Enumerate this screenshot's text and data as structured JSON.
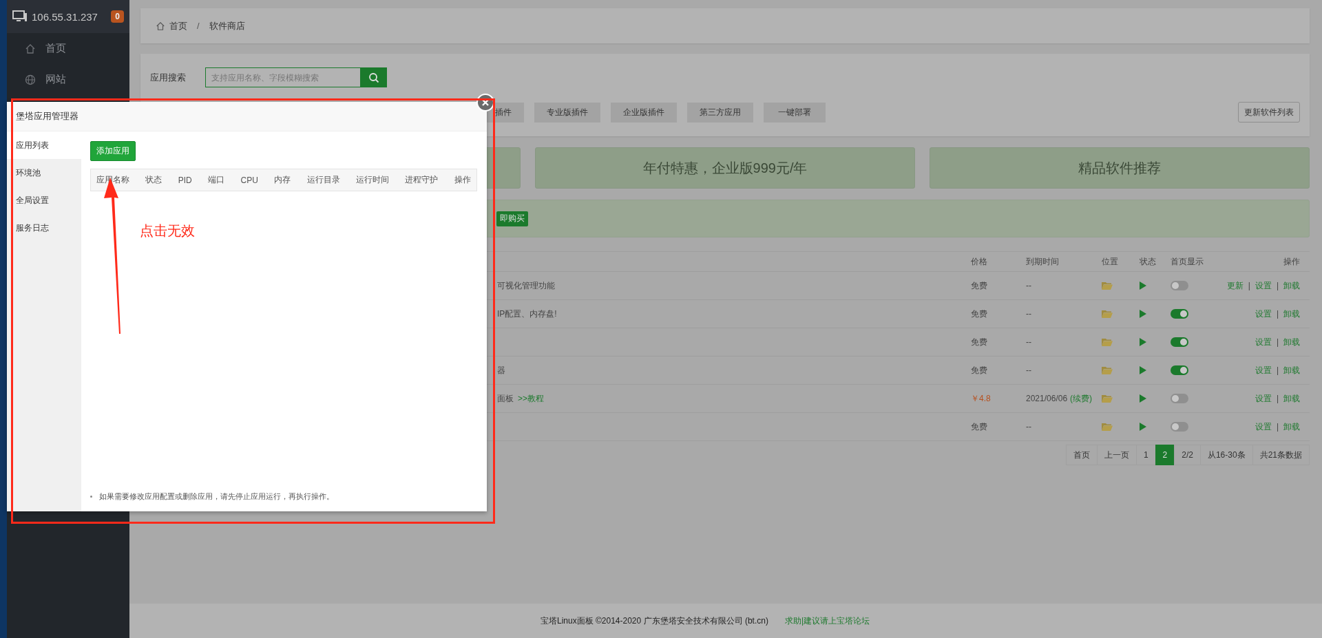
{
  "sidebar": {
    "host": "106.55.31.237",
    "badge": "0",
    "items": [
      {
        "label": "首页",
        "kind": "home"
      },
      {
        "label": "网站",
        "kind": "globe"
      }
    ]
  },
  "breadcrumb": [
    "首页",
    "软件商店"
  ],
  "breadcrumb_separator": "/",
  "search": {
    "label": "应用搜索",
    "placeholder": "支持应用名称、字段模糊搜索"
  },
  "category_tabs": [
    "插件",
    "专业版插件",
    "企业版插件",
    "第三方应用",
    "一键部署"
  ],
  "update_button": "更新软件列表",
  "banners": [
    "年付特惠，企业版999元/年",
    "精品软件推荐"
  ],
  "notice": {
    "button": "即购买"
  },
  "table": {
    "columns": [
      "价格",
      "到期时间",
      "位置",
      "状态",
      "首页显示",
      "操作"
    ],
    "separator": "|",
    "rows": [
      {
        "name": "可视化管理功能",
        "price": "免费",
        "paid": false,
        "expiry": "--",
        "home_display": false,
        "actions": [
          "更新",
          "设置",
          "卸载"
        ]
      },
      {
        "name": "IP配置、内存盘!",
        "price": "免费",
        "paid": false,
        "expiry": "--",
        "home_display": true,
        "actions": [
          "设置",
          "卸载"
        ]
      },
      {
        "price": "免费",
        "paid": false,
        "expiry": "--",
        "home_display": true,
        "actions": [
          "设置",
          "卸载"
        ]
      },
      {
        "name": "器",
        "price": "免费",
        "paid": false,
        "expiry": "--",
        "home_display": true,
        "actions": [
          "设置",
          "卸载"
        ]
      },
      {
        "name": "面板",
        "link": ">>教程",
        "price": "￥4.8",
        "paid": true,
        "expiry": "2021/06/06",
        "renew": "(续费)",
        "home_display": false,
        "actions": [
          "设置",
          "卸载"
        ]
      },
      {
        "price": "免费",
        "paid": false,
        "expiry": "--",
        "home_display": false,
        "actions": [
          "设置",
          "卸载"
        ]
      }
    ]
  },
  "pagination": [
    {
      "label": "首页",
      "selected": false
    },
    {
      "label": "上一页",
      "selected": false
    },
    {
      "label": "1",
      "selected": false
    },
    {
      "label": "2",
      "selected": true
    },
    {
      "label": "2/2",
      "selected": false
    },
    {
      "label": "从16-30条",
      "selected": false
    },
    {
      "label": "共21条数据",
      "selected": false
    }
  ],
  "footer": {
    "copyright": "宝塔Linux面板 ©2014-2020 广东堡塔安全技术有限公司 (bt.cn)",
    "link": "求助|建议请上宝塔论坛"
  },
  "modal": {
    "title": "堡塔应用管理器",
    "nav": [
      {
        "label": "应用列表",
        "selected": true
      },
      {
        "label": "环境池",
        "selected": false
      },
      {
        "label": "全局设置",
        "selected": false
      },
      {
        "label": "服务日志",
        "selected": false
      }
    ],
    "add_button": "添加应用",
    "columns": [
      "应用名称",
      "状态",
      "PID",
      "端口",
      "CPU",
      "内存",
      "运行目录",
      "运行时间",
      "进程守护",
      "操作"
    ],
    "note": "如果需要修改应用配置或删除应用，请先停止应用运行，再执行操作。"
  },
  "annotation": {
    "text": "点击无效"
  }
}
